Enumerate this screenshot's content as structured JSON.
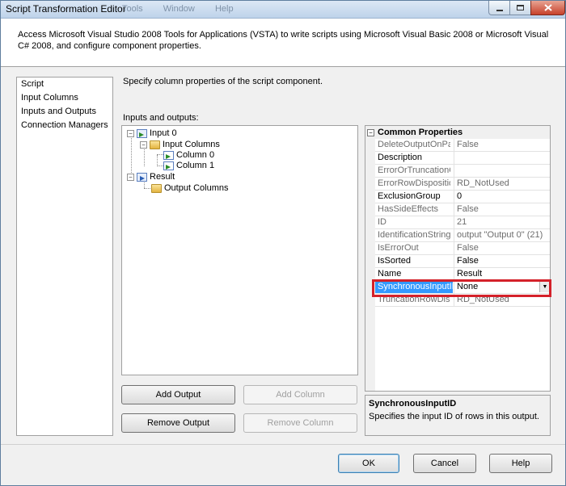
{
  "window": {
    "title": "Script Transformation Editor",
    "ghost_menu": [
      "Tools",
      "Window",
      "Help"
    ],
    "controls": {
      "minimize_icon": "minimize-icon",
      "maximize_icon": "maximize-icon",
      "close_icon": "close-icon"
    }
  },
  "header": {
    "description": "Access Microsoft Visual Studio 2008 Tools for Applications (VSTA) to write scripts using Microsoft Visual Basic 2008 or Microsoft Visual C# 2008, and configure component properties."
  },
  "nav": {
    "items": [
      {
        "label": "Script"
      },
      {
        "label": "Input Columns"
      },
      {
        "label": "Inputs and Outputs"
      },
      {
        "label": "Connection Managers"
      }
    ],
    "selected": "Inputs and Outputs"
  },
  "main": {
    "instruction": "Specify column properties of the script component.",
    "io_label": "Inputs and outputs:",
    "tree": {
      "input0": "Input 0",
      "input_columns": "Input Columns",
      "column0": "Column 0",
      "column1": "Column 1",
      "result": "Result",
      "output_columns": "Output Columns"
    },
    "buttons": {
      "add_output": "Add Output",
      "add_column": "Add Column",
      "remove_output": "Remove Output",
      "remove_column": "Remove Column"
    }
  },
  "properties": {
    "category": "Common Properties",
    "rows": [
      {
        "name": "DeleteOutputOnPathDetached",
        "value": "False",
        "readonly": true
      },
      {
        "name": "Description",
        "value": "",
        "readonly": false
      },
      {
        "name": "ErrorOrTruncationOperation",
        "value": "",
        "readonly": true
      },
      {
        "name": "ErrorRowDisposition",
        "value": "RD_NotUsed",
        "readonly": true
      },
      {
        "name": "ExclusionGroup",
        "value": "0",
        "readonly": false
      },
      {
        "name": "HasSideEffects",
        "value": "False",
        "readonly": true
      },
      {
        "name": "ID",
        "value": "21",
        "readonly": true
      },
      {
        "name": "IdentificationString",
        "value": "output \"Output 0\" (21)",
        "readonly": true
      },
      {
        "name": "IsErrorOut",
        "value": "False",
        "readonly": true
      },
      {
        "name": "IsSorted",
        "value": "False",
        "readonly": false
      },
      {
        "name": "Name",
        "value": "Result",
        "readonly": false
      },
      {
        "name": "SynchronousInputID",
        "value": "None",
        "readonly": false
      },
      {
        "name": "TruncationRowDisposition",
        "value": "RD_NotUsed",
        "readonly": true
      }
    ],
    "description_title": "SynchronousInputID",
    "description_text": "Specifies the input ID of rows in this output.",
    "highlight_color": "#d4212a",
    "selection_color": "#3399ff"
  },
  "footer": {
    "ok": "OK",
    "cancel": "Cancel",
    "help": "Help"
  }
}
